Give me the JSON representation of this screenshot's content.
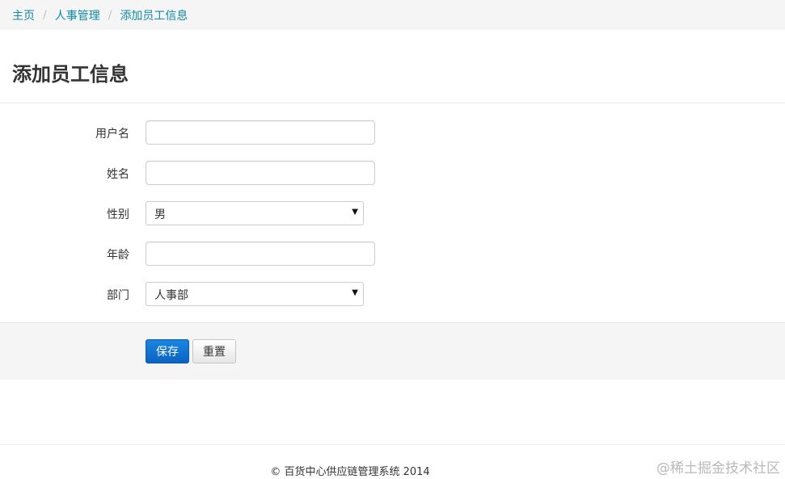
{
  "breadcrumb": {
    "items": [
      "主页",
      "人事管理",
      "添加员工信息"
    ],
    "separator": "/"
  },
  "page": {
    "title": "添加员工信息"
  },
  "form": {
    "username": {
      "label": "用户名",
      "value": ""
    },
    "name": {
      "label": "姓名",
      "value": ""
    },
    "gender": {
      "label": "性别",
      "selected": "男"
    },
    "age": {
      "label": "年龄",
      "value": ""
    },
    "department": {
      "label": "部门",
      "selected": "人事部"
    }
  },
  "actions": {
    "save_label": "保存",
    "reset_label": "重置"
  },
  "footer": {
    "text": "© 百货中心供应链管理系统 2014"
  },
  "watermark": {
    "text": "@稀土掘金技术社区"
  },
  "colors": {
    "link": "#0e8aa8",
    "primary": "#0b63c3"
  }
}
